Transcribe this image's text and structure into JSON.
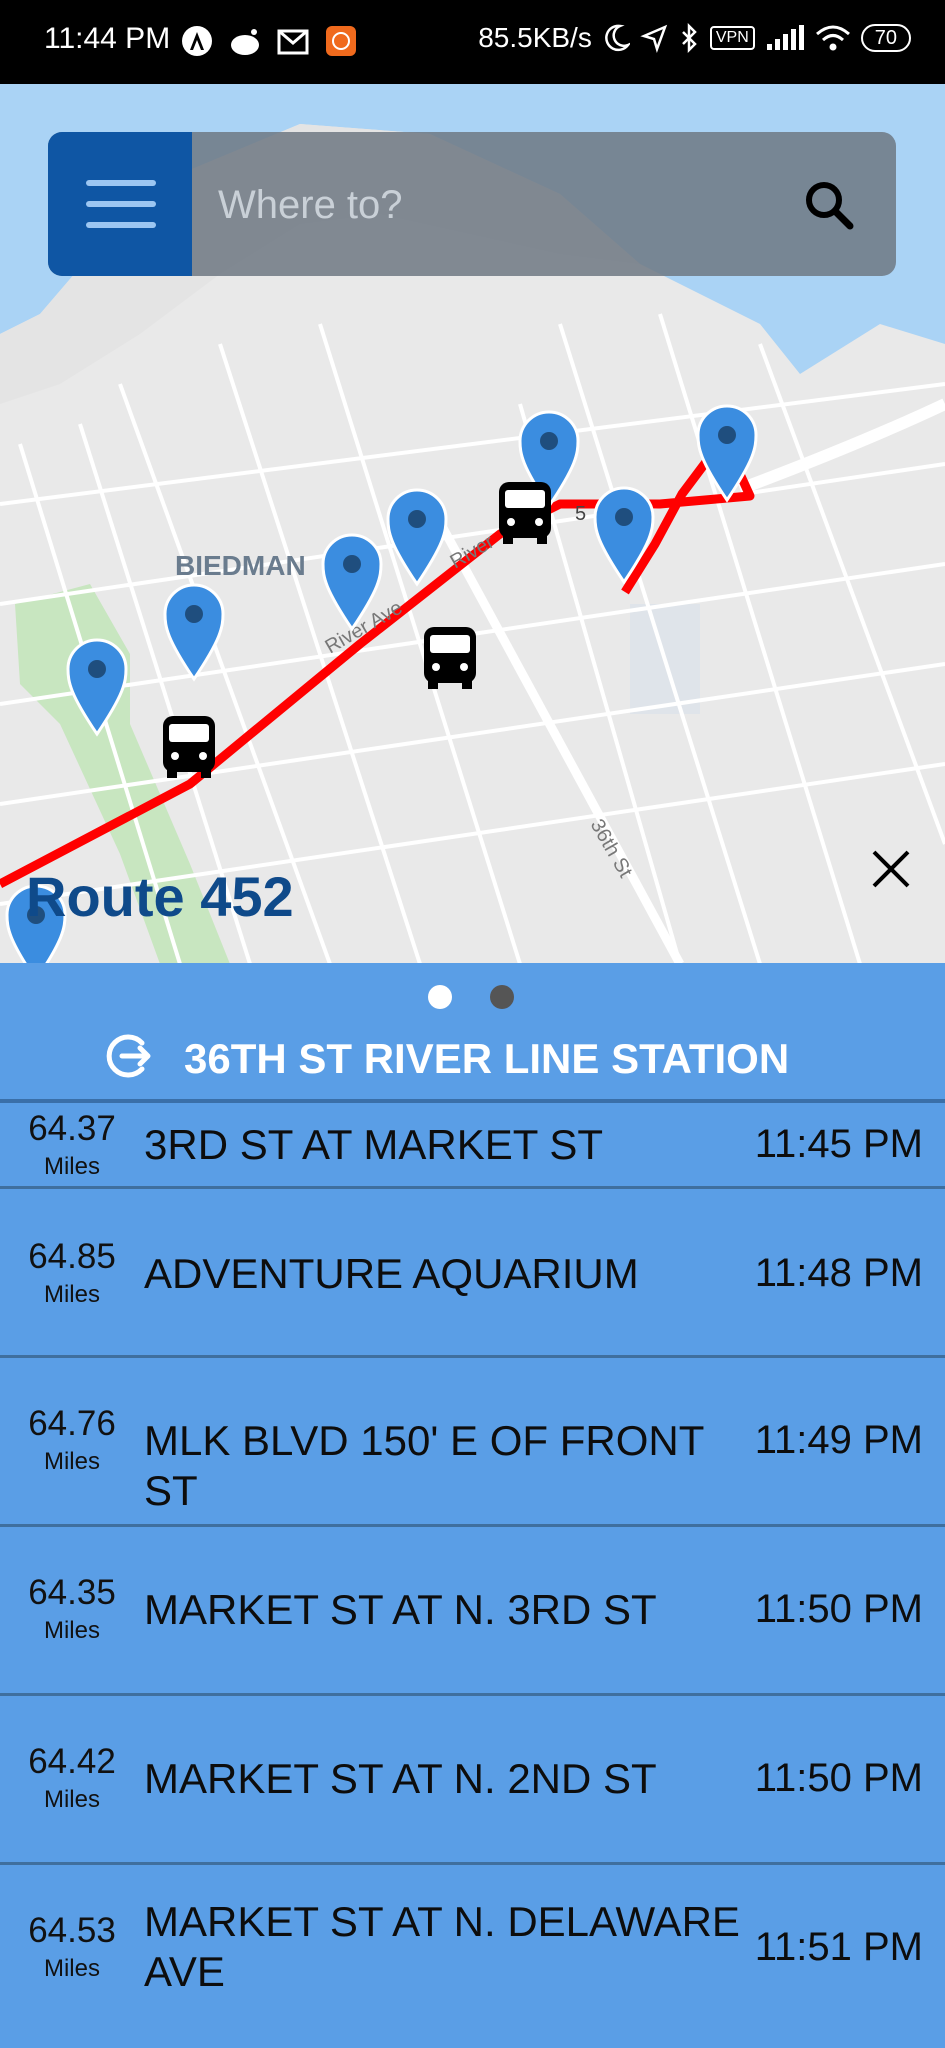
{
  "status_bar": {
    "time": "11:44 PM",
    "speed": "85.5KB/s",
    "battery": "70",
    "vpn": "VPN"
  },
  "search": {
    "placeholder": "Where to?"
  },
  "map": {
    "street_labels": [
      "BIEDMAN",
      "River Ave",
      "River",
      "36th St",
      "5"
    ],
    "route_title": "Route 452",
    "route_color": "#ff0000",
    "pin_color": "#3b8de0",
    "water_color": "#aad3f5",
    "park_color": "#c8e6c0"
  },
  "panel": {
    "page_dots": 2,
    "active_dot": 0,
    "station_name": "36TH ST RIVER LINE STATION",
    "stops": [
      {
        "distance": "64.37",
        "unit": "Miles",
        "name": "3RD ST AT MARKET ST",
        "time": "11:45 PM"
      },
      {
        "distance": "64.85",
        "unit": "Miles",
        "name": "ADVENTURE AQUARIUM",
        "time": "11:48 PM"
      },
      {
        "distance": "64.76",
        "unit": "Miles",
        "name": "MLK BLVD 150' E OF FRONT ST",
        "time": "11:49 PM"
      },
      {
        "distance": "64.35",
        "unit": "Miles",
        "name": "MARKET ST AT N. 3RD ST",
        "time": "11:50 PM"
      },
      {
        "distance": "64.42",
        "unit": "Miles",
        "name": "MARKET ST AT N. 2ND ST",
        "time": "11:50 PM"
      },
      {
        "distance": "64.53",
        "unit": "Miles",
        "name": "MARKET ST AT N. DELAWARE AVE",
        "time": "11:51 PM"
      }
    ]
  }
}
